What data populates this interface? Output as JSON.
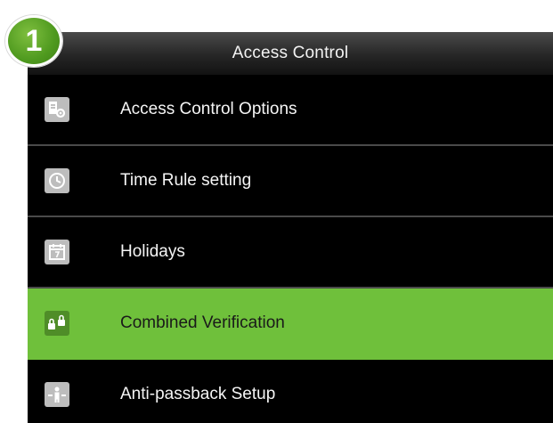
{
  "step_badge": {
    "number": "1",
    "color": "#5aa326"
  },
  "header": {
    "title": "Access Control"
  },
  "menu": {
    "selected_index": 3,
    "selected_color": "#6fc03b",
    "items": [
      {
        "label": "Access Control Options",
        "icon": "settings-document-icon"
      },
      {
        "label": "Time Rule setting",
        "icon": "clock-icon"
      },
      {
        "label": "Holidays",
        "icon": "calendar-icon"
      },
      {
        "label": "Combined Verification",
        "icon": "locks-icon"
      },
      {
        "label": "Anti-passback Setup",
        "icon": "anti-passback-icon"
      }
    ]
  }
}
